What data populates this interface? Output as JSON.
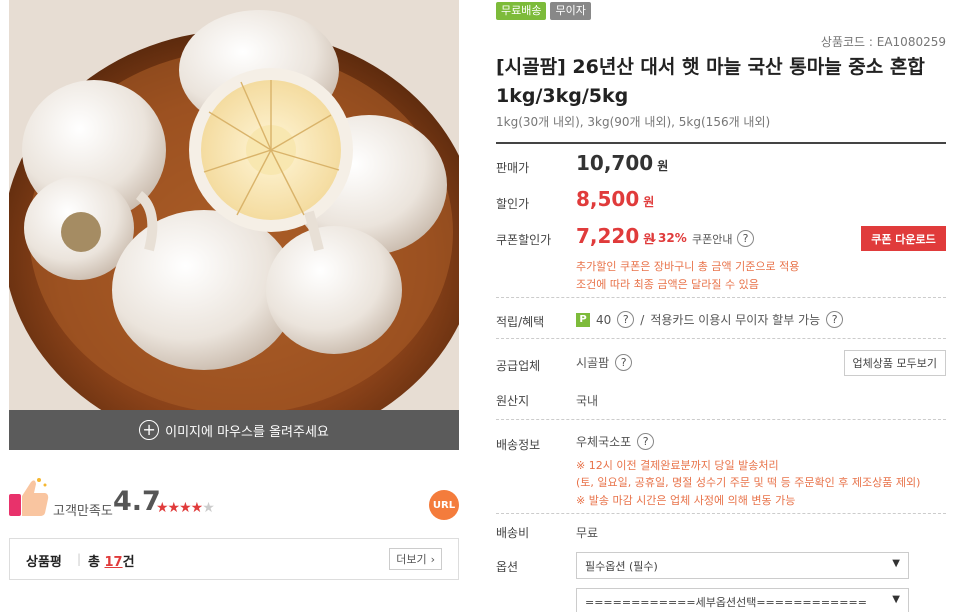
{
  "image_caption": "이미지에 마우스를 올려주세요",
  "rating": {
    "label": "고객만족도",
    "value": "4.7",
    "score": 4.7,
    "max": 5
  },
  "url_button": "URL",
  "review": {
    "title": "상품평",
    "sep": "|",
    "count_prefix": "총",
    "count": "17",
    "count_suffix": "건",
    "more": "더보기",
    "more_icon": "chevron-right-icon"
  },
  "badges": [
    "무료배송",
    "무이자"
  ],
  "product_code": "상품코드 : EA1080259",
  "title": "[시골팜] 26년산 대서 햇 마늘 국산 통마늘 중소 혼합 1kg/3kg/5kg",
  "subtitle": "1kg(30개 내외), 3kg(90개 내외), 5kg(156개 내외)",
  "price": {
    "normal_label": "판매가",
    "normal_value": "10,700",
    "won": "원",
    "sale_label": "할인가",
    "sale_value": "8,500",
    "coupon_label": "쿠폰할인가",
    "coupon_value": "7,220",
    "discount": "↓32%",
    "coupon_guide": "쿠폰안내",
    "coupon_button": "쿠폰 다운로드",
    "coupon_note_1": "추가할인 쿠폰은 장바구니 총 금액 기준으로 적용",
    "coupon_note_2": "조건에 따라 최종 금액은 달라질 수 있음"
  },
  "points": {
    "label": "적립/혜택",
    "p": "P",
    "value": "40",
    "slash": "/",
    "card_text": "적용카드 이용시 무이자 할부 가능"
  },
  "vendor": {
    "label": "공급업체",
    "value": "시골팜",
    "button": "업체상품 모두보기"
  },
  "origin": {
    "label": "원산지",
    "value": "국내"
  },
  "shipping": {
    "label": "배송정보",
    "value": "우체국소포",
    "note_1": "※ 12시 이전 결제완료분까지 당일 발송처리",
    "note_2": "(토, 일요일, 공휴일, 명절 성수기 주문 및 떡 등 주문확인 후 제조상품 제외)",
    "note_3": "※ 발송 마감 시간은 업체 사정에 의해 변동 가능"
  },
  "shipping_fee": {
    "label": "배송비",
    "value": "무료"
  },
  "options": {
    "label": "옵션",
    "required": "필수옵션 (필수)",
    "sub": "============세부옵션선택============"
  },
  "colors": {
    "accent": "#e03b3b",
    "note": "#e8734a",
    "badge_green": "#7dbb3a",
    "url": "#f47c3c"
  }
}
